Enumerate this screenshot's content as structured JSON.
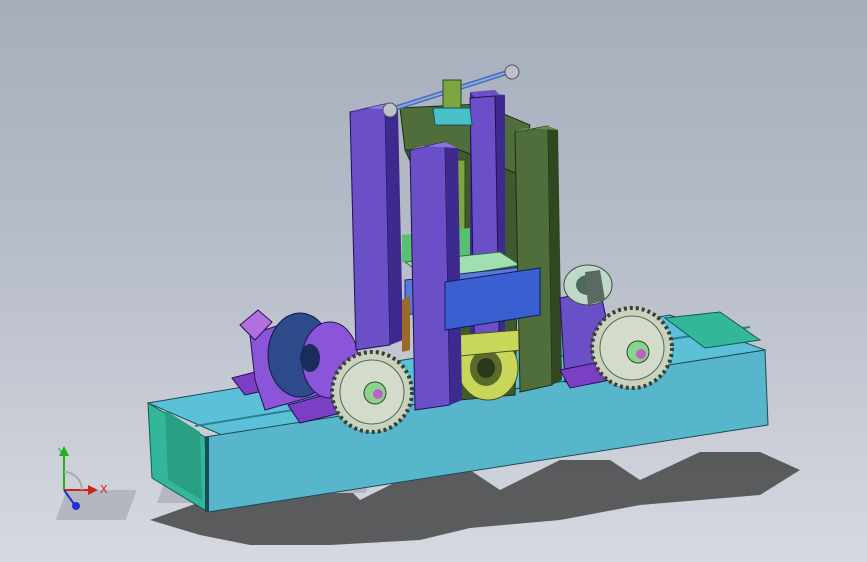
{
  "viewport": {
    "background_top": "#a6aebc",
    "background_bottom": "#d6d9e0"
  },
  "model": {
    "description_icon": "cad-assembly-roller-press",
    "colors": {
      "base_frame": "#5bb8d0",
      "base_frame_dark": "#2a7f92",
      "end_plate": "#33b899",
      "column_purple": "#6a4fc7",
      "column_purple_dark": "#3e2a8f",
      "column_green": "#4f6e3c",
      "column_green_dark": "#30471f",
      "gear": "#c9d3c0",
      "gear_dark": "#7f8c78",
      "bearing_purple": "#9a4fd6",
      "bearing_block": "#8b5ad8",
      "shaft_blue": "#2d4a8a",
      "screw_green": "#7ba641",
      "nut_cyan": "#4ac0c8",
      "plate_blue": "#3a5fd0",
      "roller_yellow": "#c8d65a",
      "shadow": "#3a3a3a"
    }
  },
  "triad": {
    "x_label": "X",
    "y_label": "Y",
    "x_color": "#d62020",
    "y_color": "#20b020",
    "z_color": "#2030d0"
  }
}
